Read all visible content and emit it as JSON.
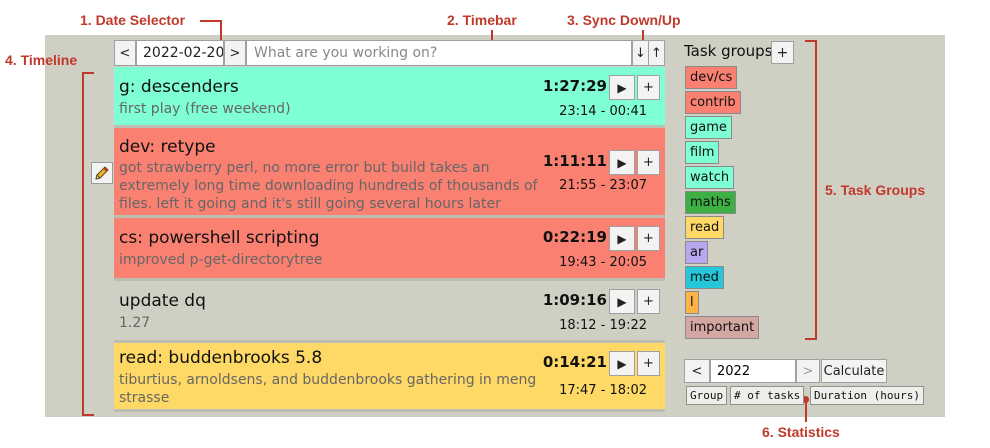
{
  "annotations": {
    "date_selector": "1. Date Selector",
    "timebar": "2. Timebar",
    "sync": "3. Sync Down/Up",
    "timeline": "4. Timeline",
    "task_groups": "5. Task Groups",
    "statistics": "6. Statistics"
  },
  "topbar": {
    "prev_label": "<",
    "date_value": "2022-02-20",
    "next_label": ">",
    "timebar_placeholder": "What are you working on?",
    "sync_down": "↓",
    "sync_up": "↑"
  },
  "tasks": [
    {
      "title": "g: descenders",
      "desc": "first play (free weekend)",
      "duration": "1:27:29",
      "range": "23:14 - 00:41",
      "color": "#7fffd4"
    },
    {
      "title": "dev: retype",
      "desc": "got strawberry perl, no more error but build takes an extremely long time downloading hundreds of thousands of files. left it going and it's still going several hours later",
      "duration": "1:11:11",
      "range": "21:55 - 23:07",
      "color": "#fa8072"
    },
    {
      "title": "cs: powershell scripting",
      "desc": "improved p-get-directorytree",
      "duration": "0:22:19",
      "range": "19:43 - 20:05",
      "color": "#fa8072"
    },
    {
      "title": "update dq",
      "desc": "1.27",
      "duration": "1:09:16",
      "range": "18:12 - 19:22",
      "color": "#d0cfc3"
    },
    {
      "title": "read: buddenbrooks 5.8",
      "desc": "tiburtius, arnoldsens, and buddenbrooks gathering in meng strasse",
      "duration": "0:14:21",
      "range": "17:47 - 18:02",
      "color": "#ffd966"
    }
  ],
  "task_buttons": {
    "play": "▶",
    "add": "+"
  },
  "task_groups": {
    "header": "Task groups",
    "add_label": "+",
    "items": [
      {
        "name": "dev/cs",
        "color": "#fa8072"
      },
      {
        "name": "contrib",
        "color": "#fa8072"
      },
      {
        "name": "game",
        "color": "#7fffd4"
      },
      {
        "name": "film",
        "color": "#7fffd4"
      },
      {
        "name": "watch",
        "color": "#7fffd4"
      },
      {
        "name": "maths",
        "color": "#3cb043"
      },
      {
        "name": "read",
        "color": "#ffd966"
      },
      {
        "name": "ar",
        "color": "#b9a7f0"
      },
      {
        "name": "med",
        "color": "#26c6da"
      },
      {
        "name": "l",
        "color": "#ffb347"
      },
      {
        "name": "important",
        "color": "#d4a7a3"
      }
    ]
  },
  "statistics": {
    "prev_label": "<",
    "year_value": "2022",
    "next_label": ">",
    "calculate_label": "Calculate",
    "columns": [
      "Group",
      "# of tasks",
      "Duration (hours)"
    ]
  }
}
